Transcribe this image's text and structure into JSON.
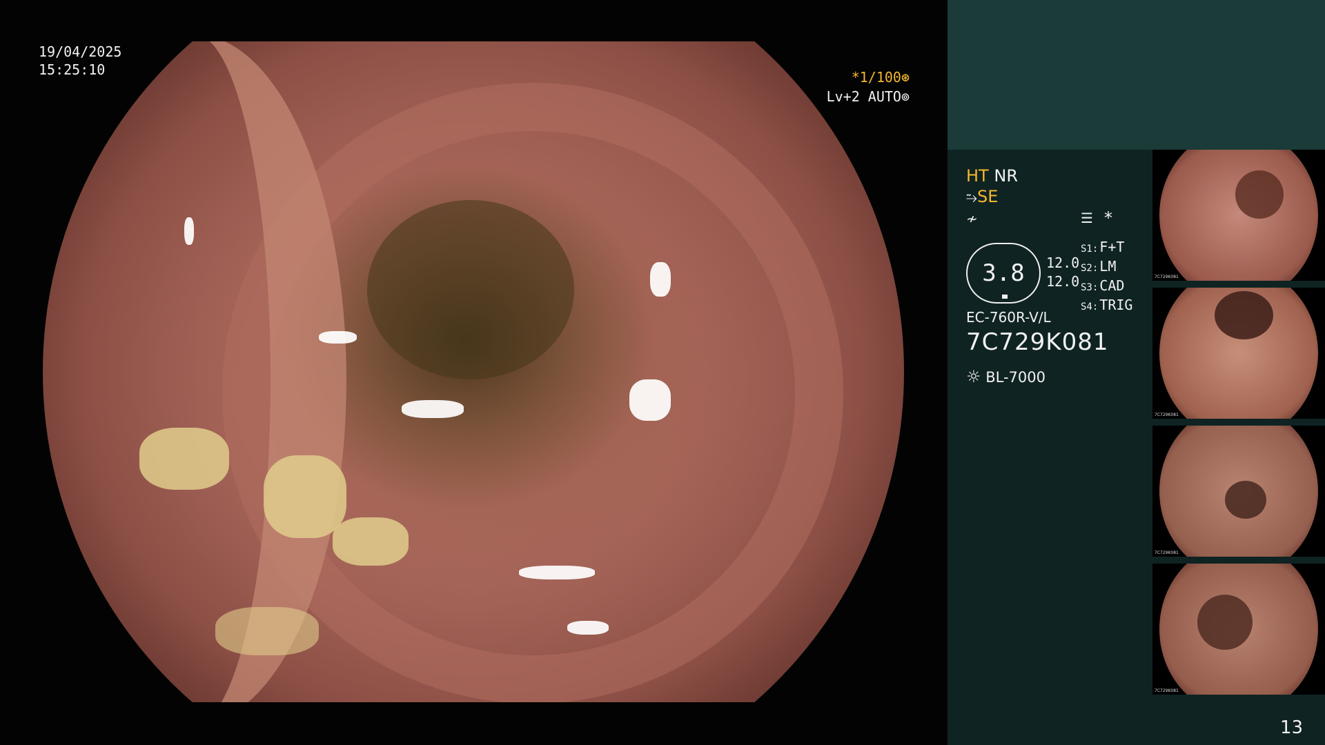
{
  "overlay": {
    "date": "19/04/2025",
    "time": "15:25:10",
    "shutter": "*1/100",
    "level": "Lv+2 AUTO"
  },
  "panel": {
    "modes": {
      "ht": "HT",
      "nr": "NR",
      "se": "SE"
    },
    "dial_value": "3.8",
    "values": [
      "12.0",
      "12.0"
    ],
    "switches": [
      {
        "key": "S1:",
        "value": "F+T"
      },
      {
        "key": "S2:",
        "value": "LM"
      },
      {
        "key": "S3:",
        "value": "CAD"
      },
      {
        "key": "S4:",
        "value": "TRIG"
      }
    ],
    "scope_model": "EC-760R-V/L",
    "serial": "7C729K081",
    "light_source": "BL-7000",
    "asterisk": "*"
  },
  "thumbnails": [
    {
      "caption": "7C729K081"
    },
    {
      "caption": "7C729K081"
    },
    {
      "caption": "7C729K081"
    },
    {
      "caption": "7C729K081"
    }
  ],
  "page_number": "13",
  "colors": {
    "accent": "#f5b82e",
    "panel_bg": "#0f2323",
    "panel_top": "#1a3b37"
  }
}
